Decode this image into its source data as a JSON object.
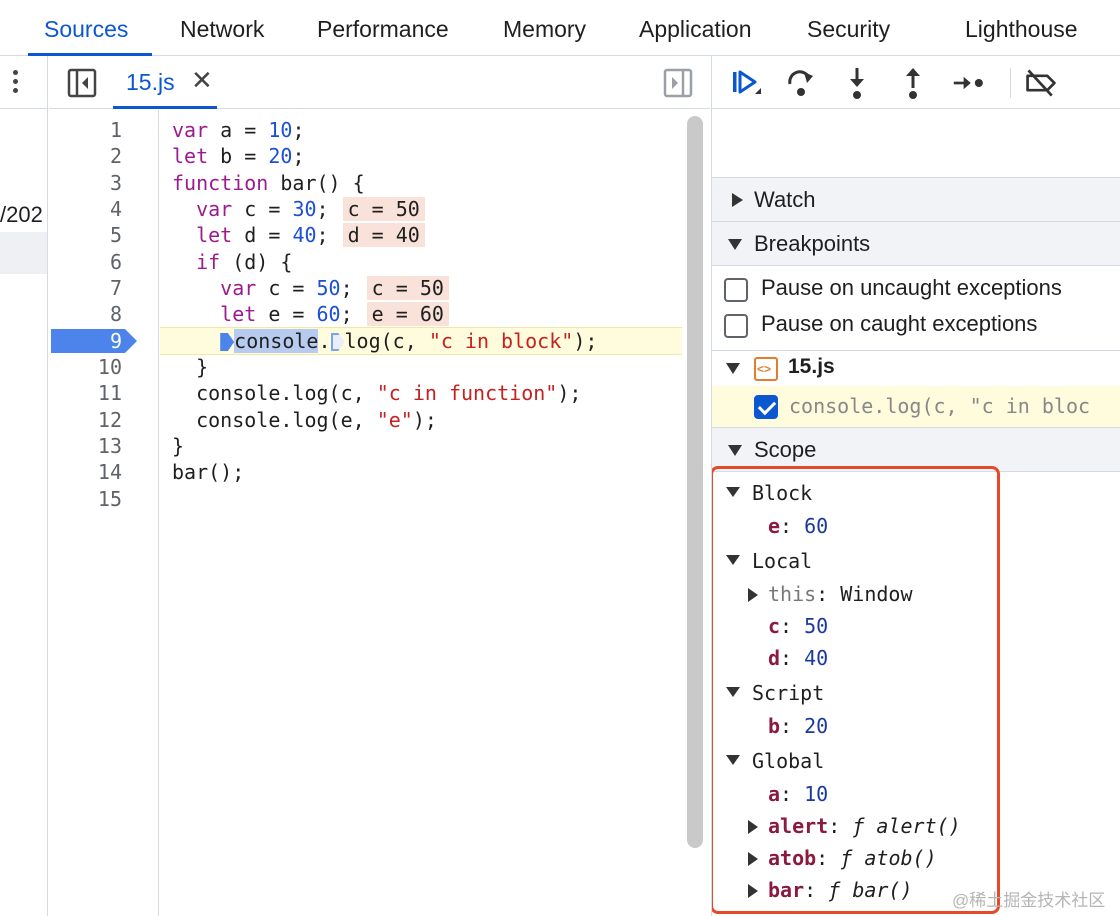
{
  "tabs": [
    "Sources",
    "Network",
    "Performance",
    "Memory",
    "Application",
    "Security",
    "Lighthouse"
  ],
  "active_tab": "Sources",
  "navigator": {
    "partial_text": "/202"
  },
  "editor": {
    "file_tab": "15.js",
    "close_glyph": "✕",
    "line_numbers": [
      "1",
      "2",
      "3",
      "4",
      "5",
      "6",
      "7",
      "8",
      "9",
      "10",
      "11",
      "12",
      "13",
      "14",
      "15"
    ],
    "paused_line": "9",
    "code": {
      "l1": {
        "kw": "var",
        "a": " a = ",
        "n": "10",
        "b": ";"
      },
      "l2": {
        "kw": "let",
        "a": " b = ",
        "n": "20",
        "b": ";"
      },
      "l3": {
        "kw": "function",
        "a": " bar() {"
      },
      "l4": {
        "ind": "  ",
        "kw": "var",
        "a": " c = ",
        "n": "30",
        "b": ";",
        "inline": "c = 50"
      },
      "l5": {
        "ind": "  ",
        "kw": "let",
        "a": " d = ",
        "n": "40",
        "b": ";",
        "inline": "d = 40"
      },
      "l6": {
        "ind": "  ",
        "kw": "if",
        "a": " (d) {"
      },
      "l7": {
        "ind": "    ",
        "kw": "var",
        "a": " c = ",
        "n": "50",
        "b": ";",
        "inline": "c = 50"
      },
      "l8": {
        "ind": "    ",
        "kw": "let",
        "a": " e = ",
        "n": "60",
        "b": ";",
        "inline": "e = 60"
      },
      "l9": {
        "ind": "    ",
        "hl": "console",
        "dot": ".",
        "a": "log(c, ",
        "s": "\"c in block\"",
        "b": ");"
      },
      "l10": {
        "t": "  }"
      },
      "l11": {
        "a": "  console.log(c, ",
        "s": "\"c in function\"",
        "b": ");"
      },
      "l12": {
        "a": "  console.log(e, ",
        "s": "\"e\"",
        "b": ");"
      },
      "l13": {
        "t": "}"
      },
      "l14": {
        "t": "bar();"
      }
    }
  },
  "sidebar": {
    "watch": "Watch",
    "breakpoints": "Breakpoints",
    "pause_uncaught": "Pause on uncaught exceptions",
    "pause_caught": "Pause on caught exceptions",
    "bp_file": "15.js",
    "bp_code": "console.log(c, \"c in bloc",
    "scope": "Scope",
    "scopes": {
      "block": {
        "title": "Block",
        "e_key": "e",
        "e_val": "60"
      },
      "local": {
        "title": "Local",
        "this_key": "this",
        "this_val": "Window",
        "c_key": "c",
        "c_val": "50",
        "d_key": "d",
        "d_val": "40"
      },
      "script": {
        "title": "Script",
        "b_key": "b",
        "b_val": "20"
      },
      "global": {
        "title": "Global",
        "a_key": "a",
        "a_val": "10",
        "alert_key": "alert",
        "alert_val": "alert()",
        "atob_key": "atob",
        "atob_val": "atob()",
        "bar_key": "bar",
        "bar_val": "bar()",
        "f": "ƒ"
      }
    },
    "colon": ":"
  },
  "watermark": "@稀土掘金技术社区",
  "colors": {
    "accent": "#0b57d0",
    "breakpoint": "#4c84ec",
    "exec_line": "#fffbdd",
    "inline_value": "#f9e2d9",
    "annotation": "#e4492a"
  },
  "icons": [
    "more-vert-icon",
    "toggle-navigator-icon",
    "toggle-debugger-icon",
    "resume-icon",
    "step-over-icon",
    "step-into-icon",
    "step-out-icon",
    "step-icon",
    "deactivate-breakpoints-icon",
    "file-script-icon"
  ]
}
